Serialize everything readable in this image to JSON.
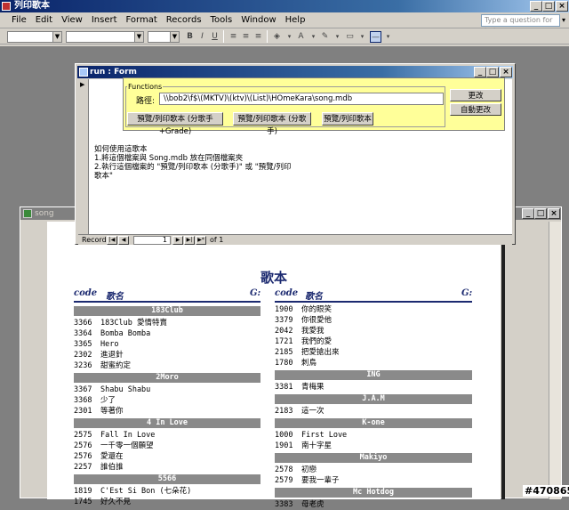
{
  "app": {
    "title": "列印歌本",
    "caption_buttons": [
      "_",
      "□",
      "×"
    ]
  },
  "menu": {
    "items": [
      "File",
      "Edit",
      "View",
      "Insert",
      "Format",
      "Records",
      "Tools",
      "Window",
      "Help"
    ],
    "help_placeholder": "Type a question for help"
  },
  "run_form": {
    "title": "run : Form",
    "group_label": "Functions",
    "path_label": "路徑:",
    "path_value": "\\\\bob2\\f$\\(MKTV)\\(ktv)\\(List)\\HOmeKara\\song.mdb",
    "btn_change": "更改",
    "btn_auto_change": "自動更改",
    "btn_preview_print_singer_grade": "預覽/列印歌本 (分歌手+Grade)",
    "btn_preview_print_singer": "預覽/列印歌本 (分歌手)",
    "btn_preview_print": "預覽/列印歌本",
    "instructions": "如何使用這歌本\n1.將這個檔案與 Song.mdb 放在同個檔案夾\n2.執行這個檔案的 \"預覽/列印歌本 (分歌手)\" 或 \"預覽/列印\n歌本\"",
    "nav": {
      "record_label": "Record:",
      "current": "1",
      "of_text": "of 1"
    }
  },
  "song_window": {
    "title": "song"
  },
  "report": {
    "title": "歌本",
    "col_code": "code",
    "col_name": "歌名",
    "col_g": "G:",
    "left": [
      {
        "type": "group",
        "text": "183Club"
      },
      {
        "type": "row",
        "code": "3366",
        "name": "183Club 愛情特賣"
      },
      {
        "type": "row",
        "code": "3364",
        "name": "Bomba Bomba"
      },
      {
        "type": "row",
        "code": "3365",
        "name": "Hero"
      },
      {
        "type": "row",
        "code": "2302",
        "name": "進退針"
      },
      {
        "type": "row",
        "code": "3236",
        "name": "甜蜜約定"
      },
      {
        "type": "group",
        "text": "2Moro"
      },
      {
        "type": "row",
        "code": "3367",
        "name": "Shabu Shabu"
      },
      {
        "type": "row",
        "code": "3368",
        "name": "少了"
      },
      {
        "type": "row",
        "code": "2301",
        "name": "等著你"
      },
      {
        "type": "group",
        "text": "4 In Love"
      },
      {
        "type": "row",
        "code": "2575",
        "name": "Fall In Love"
      },
      {
        "type": "row",
        "code": "2576",
        "name": "一千零一個願望"
      },
      {
        "type": "row",
        "code": "2576",
        "name": "愛還在"
      },
      {
        "type": "row",
        "code": "2257",
        "name": "誰伯誰"
      },
      {
        "type": "group",
        "text": "5566"
      },
      {
        "type": "row",
        "code": "1819",
        "name": "C'Est Si Bon (七朵花)"
      },
      {
        "type": "row",
        "code": "1745",
        "name": "好久不見"
      }
    ],
    "right": [
      {
        "type": "row",
        "code": "1900",
        "name": "你的眼笑"
      },
      {
        "type": "row",
        "code": "3379",
        "name": "你很愛他"
      },
      {
        "type": "row",
        "code": "2042",
        "name": "我愛我"
      },
      {
        "type": "row",
        "code": "1721",
        "name": "我們的愛"
      },
      {
        "type": "row",
        "code": "2185",
        "name": "把愛搶出來"
      },
      {
        "type": "row",
        "code": "1780",
        "name": "刺鳥"
      },
      {
        "type": "group",
        "text": "ING"
      },
      {
        "type": "row",
        "code": "3381",
        "name": "青梅果"
      },
      {
        "type": "group",
        "text": "J.A.M"
      },
      {
        "type": "row",
        "code": "2183",
        "name": "這一次"
      },
      {
        "type": "group",
        "text": "K-one"
      },
      {
        "type": "row",
        "code": "1000",
        "name": "First Love"
      },
      {
        "type": "row",
        "code": "1901",
        "name": "南十字星"
      },
      {
        "type": "group",
        "text": "Makiyo"
      },
      {
        "type": "row",
        "code": "2578",
        "name": "初戀"
      },
      {
        "type": "row",
        "code": "2579",
        "name": "要我一輩子"
      },
      {
        "type": "group",
        "text": "Mc Hotdog"
      },
      {
        "type": "row",
        "code": "3383",
        "name": "母老虎"
      }
    ]
  },
  "watermark": "#470865"
}
